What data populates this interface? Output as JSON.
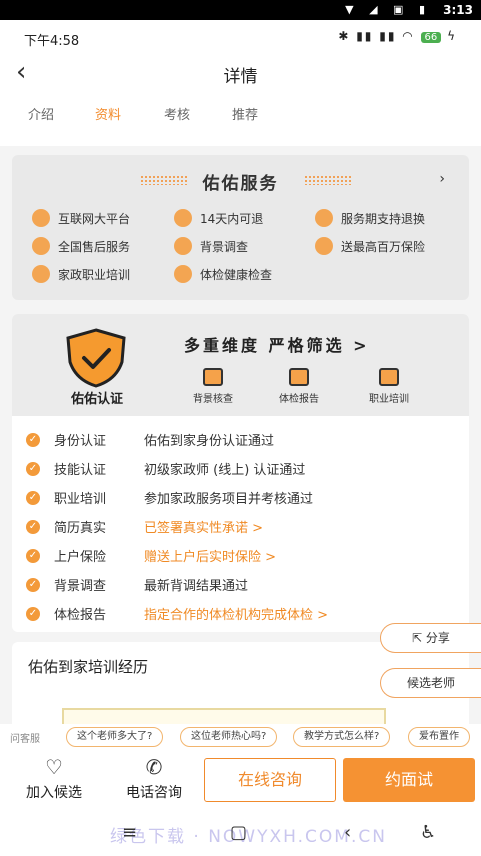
{
  "system": {
    "time": "3:13"
  },
  "status": {
    "time": "下午4:58",
    "battery": "66"
  },
  "nav": {
    "title": "详情"
  },
  "tabs": [
    "介绍",
    "资料",
    "考核",
    "推荐"
  ],
  "service": {
    "title": "佑佑服务",
    "items": [
      "互联网大平台",
      "14天内可退",
      "服务期支持退换",
      "全国售后服务",
      "背景调查",
      "送最高百万保险",
      "家政职业培训",
      "体检健康检查"
    ]
  },
  "verify": {
    "badge": "佑佑认证",
    "headline": "多重维度  严格筛选 >",
    "features": [
      "背景核查",
      "体检报告",
      "职业培训"
    ],
    "rows": [
      {
        "label": "身份认证",
        "value": "佑佑到家身份认证通过"
      },
      {
        "label": "技能认证",
        "value": "初级家政师 (线上) 认证通过"
      },
      {
        "label": "职业培训",
        "value": "参加家政服务项目并考核通过"
      },
      {
        "label": "简历真实",
        "value": "已签署真实性承诺 >"
      },
      {
        "label": "上户保险",
        "value": "赠送上户后实时保险 >"
      },
      {
        "label": "背景调查",
        "value": "最新背调结果通过"
      },
      {
        "label": "体检报告",
        "value": "指定合作的体检机构完成体检 >"
      }
    ]
  },
  "training": {
    "title": "佑佑到家培训经历"
  },
  "floating": {
    "share": "分享",
    "pick_teacher": "候选老师"
  },
  "quick": {
    "label": "问客服",
    "chips": [
      "这个老师多大了?",
      "这位老师热心吗?",
      "教学方式怎么样?",
      "爱布置作"
    ]
  },
  "actions": {
    "add": "加入候选",
    "phone": "电话咨询",
    "consult": "在线咨询",
    "interview": "约面试"
  },
  "watermark": "绿色下载 · NOWYXH.COM.CN",
  "colors": {
    "accent": "#f28b2c",
    "card_bg": "#e9e9e9"
  }
}
